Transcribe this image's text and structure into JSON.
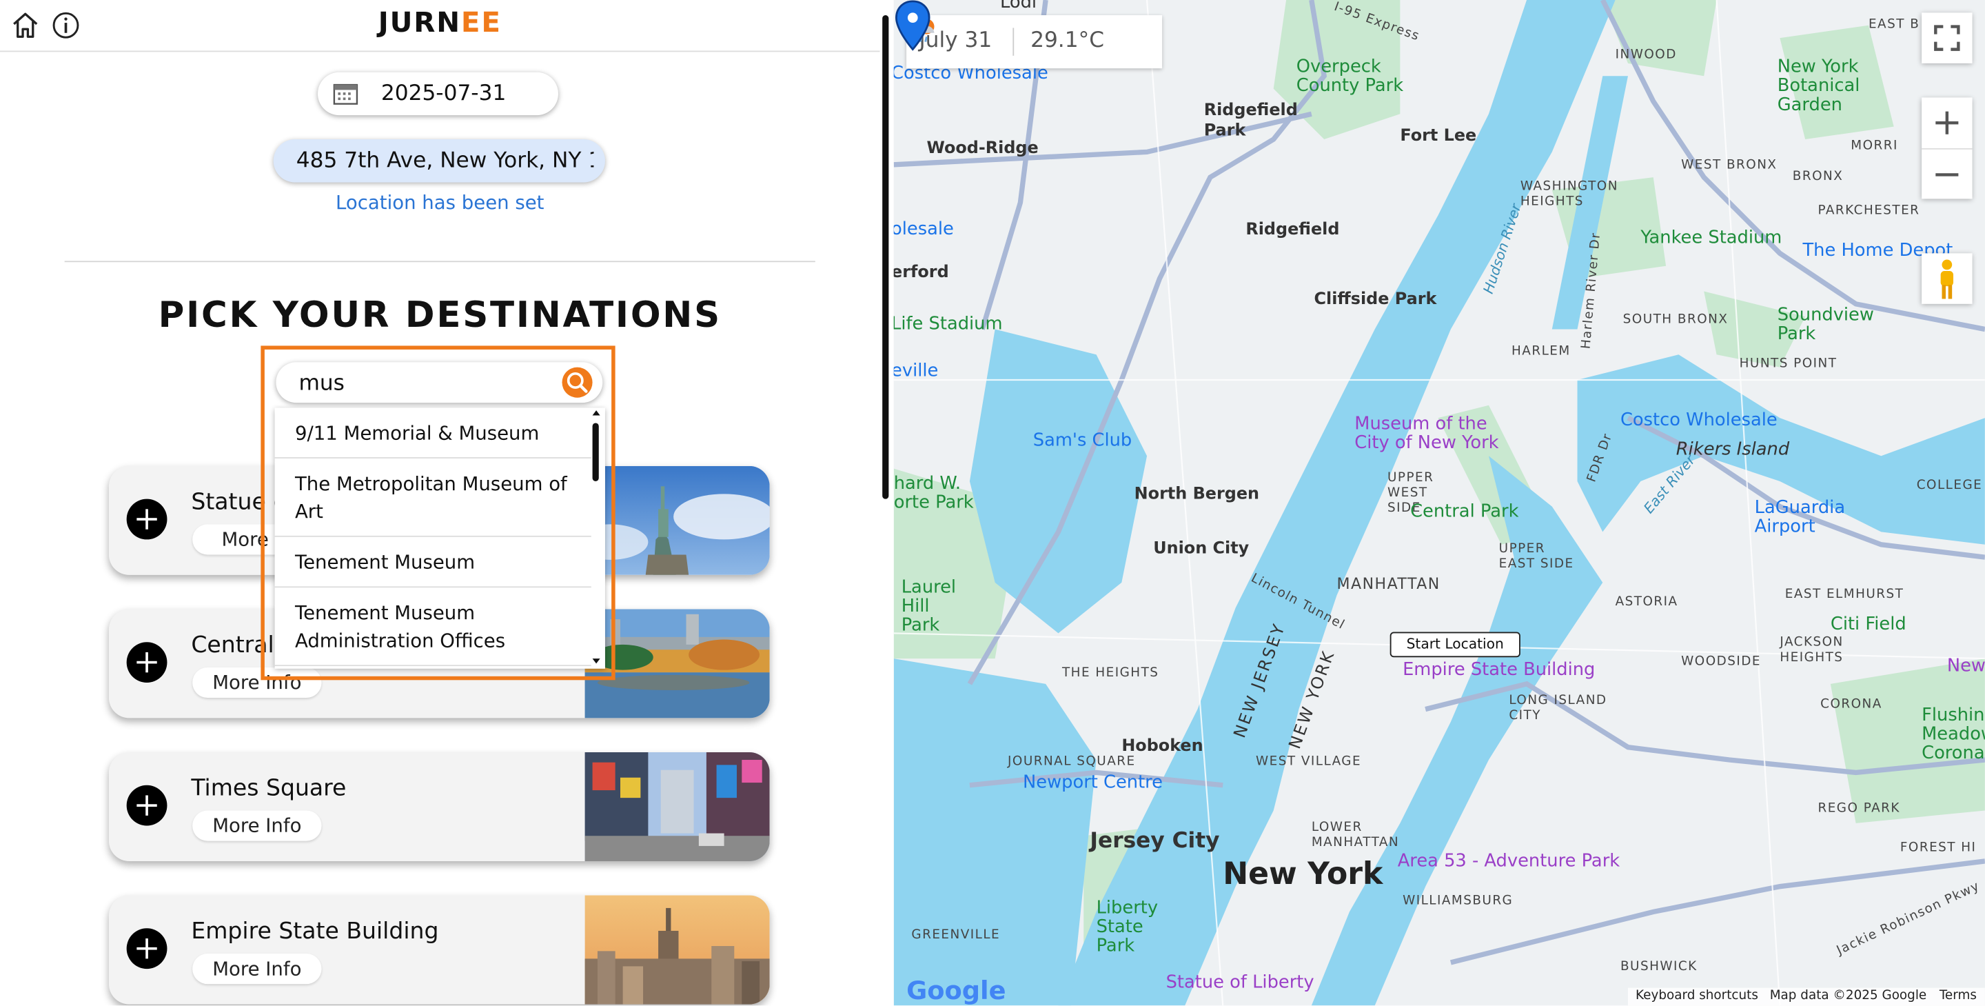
{
  "app": {
    "logo_prefix": "JURN",
    "logo_accent": "EE",
    "accent_color": "#f07a1a",
    "icons": {
      "home": "home-icon",
      "info": "info-icon",
      "calendar": "calendar-icon",
      "search": "search-icon"
    }
  },
  "trip": {
    "date": "2025-07-31",
    "location": "485 7th Ave, New York, NY 1",
    "location_status": "Location has been set"
  },
  "destinations": {
    "heading": "PICK YOUR DESTINATIONS",
    "search_value": "mus",
    "suggestions": [
      "9/11 Memorial & Museum",
      "The Metropolitan Museum of Art",
      "Tenement Museum",
      "Tenement Museum Administration Offices"
    ],
    "cards": [
      {
        "title": "Statue of Liberty",
        "visible_title": "Statue o",
        "more": "More Info",
        "more_visible": "More In"
      },
      {
        "title": "Central Park",
        "visible_title": "Central",
        "more": "More Info"
      },
      {
        "title": "Times Square",
        "more": "More Info"
      },
      {
        "title": "Empire State Building",
        "more": "More Info"
      }
    ]
  },
  "map": {
    "weather": {
      "date": "July 31",
      "temp": "29.1°C",
      "icon": "rain-cloud-icon"
    },
    "marker_label": "Start Location",
    "labels": {
      "lodi": "Lodi",
      "overpeck": "Overpeck County Park",
      "costco1": "Costco Wholesale",
      "ridgefield_park": "Ridgefield Park",
      "wood_ridge": "Wood-Ridge",
      "fort_lee": "Fort Lee",
      "ridgefield": "Ridgefield",
      "olesale": "olesale",
      "erford": "erford",
      "life_stadium": "Life Stadium",
      "cliffside": "Cliffside Park",
      "evile": "eville",
      "sams": "Sam's Club",
      "north_bergen": "North Bergen",
      "union_city": "Union City",
      "hardw": "hard W.",
      "orte_park": "orte Park",
      "laurel": "Laurel Hill Park",
      "the_heights": "THE HEIGHTS",
      "hoboken": "Hoboken",
      "journal": "JOURNAL SQUARE",
      "newport": "Newport Centre",
      "jersey_city": "Jersey City",
      "liberty_sp": "Liberty State Park",
      "greenville": "GREENVILLE",
      "statue": "Statue of Liberty",
      "new_york": "New York",
      "area53": "Area 53 - Adventure Park",
      "williamsburg": "WILLIAMSBURG",
      "bushwick": "BUSHWICK",
      "lower_manhattan": "LOWER MANHATTAN",
      "west_village": "WEST VILLAGE",
      "manhattan": "MANHATTAN",
      "empire": "Empire State Building",
      "lincoln": "Lincoln Tunnel",
      "nj": "NEW JERSEY",
      "ny": "NEW YORK",
      "museum": "Museum of the City of New York",
      "upper_west": "UPPER WEST SIDE",
      "central_park": "Central Park",
      "upper_east": "UPPER EAST SIDE",
      "harlem": "HARLEM",
      "south_bronx": "SOUTH BRONX",
      "yankee": "Yankee Stadium",
      "washington_heights": "WASHINGTON HEIGHTS",
      "inwood": "INWOOD",
      "west_bronx": "WEST BRONX",
      "bronx": "BRONX",
      "morris": "MORRI",
      "parkchester": "PARKCHESTER",
      "home_depot": "The Home Depot",
      "soundview": "Soundview Park",
      "hunts": "HUNTS POINT",
      "costco2": "Costco Wholesale",
      "rikers": "Rikers Island",
      "college": "COLLEGE",
      "laguardia": "LaGuardia Airport",
      "astoria": "ASTORIA",
      "east_elmhurst": "EAST ELMHURST",
      "citi_field": "Citi Field",
      "jackson": "JACKSON HEIGHTS",
      "woodside": "WOODSIDE",
      "lic": "LONG ISLAND CITY",
      "corona": "CORONA",
      "flushing": "Flushin Meadow Corona",
      "new_sc": "New Sc",
      "rego": "REGO PARK",
      "forest": "FOREST HI",
      "nybg": "New York Botanical Garden",
      "east_b": "EAST B",
      "hudson": "Hudson River",
      "east_river": "East River",
      "harlem_river": "Harlem River Dr",
      "fdr": "FDR Dr",
      "i95": "I-95 Express",
      "jackie": "Jackie Robinson Pkwy",
      "google": "Google",
      "keyboard": "Keyboard shortcuts",
      "mapdata": "Map data ©2025 Google",
      "terms": "Terms"
    }
  }
}
